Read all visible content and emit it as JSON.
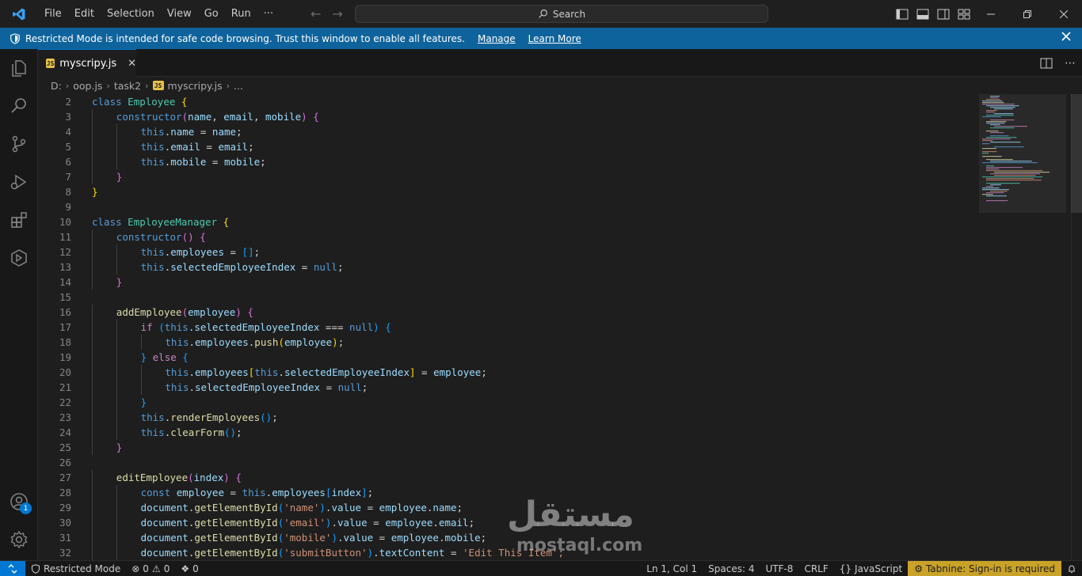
{
  "menu": [
    "File",
    "Edit",
    "Selection",
    "View",
    "Go",
    "Run",
    "···"
  ],
  "search": {
    "label": "Search"
  },
  "banner": {
    "message": "Restricted Mode is intended for safe code browsing. Trust this window to enable all features.",
    "manage": "Manage",
    "learn_more": "Learn More"
  },
  "tab": {
    "icon_text": "JS",
    "label": "myscripy.js"
  },
  "breadcrumb": [
    "D:",
    "oop.js",
    "task2",
    "myscripy.js",
    "..."
  ],
  "code_lines": [
    {
      "n": "2",
      "d": 0,
      "t": [
        [
          "kw",
          "class"
        ],
        [
          "p",
          " "
        ],
        [
          "cls",
          "Employee"
        ],
        [
          "p",
          " "
        ],
        [
          "b1",
          "{"
        ]
      ]
    },
    {
      "n": "3",
      "d": 1,
      "t": [
        [
          "kw",
          "constructor"
        ],
        [
          "b2",
          "("
        ],
        [
          "prm",
          "name"
        ],
        [
          "p",
          ", "
        ],
        [
          "prm",
          "email"
        ],
        [
          "p",
          ", "
        ],
        [
          "prm",
          "mobile"
        ],
        [
          "b2",
          ")"
        ],
        [
          "p",
          " "
        ],
        [
          "b2",
          "{"
        ]
      ]
    },
    {
      "n": "4",
      "d": 2,
      "t": [
        [
          "kw",
          "this"
        ],
        [
          "p",
          "."
        ],
        [
          "prm",
          "name"
        ],
        [
          "p",
          " = "
        ],
        [
          "prm",
          "name"
        ],
        [
          "p",
          ";"
        ]
      ]
    },
    {
      "n": "5",
      "d": 2,
      "t": [
        [
          "kw",
          "this"
        ],
        [
          "p",
          "."
        ],
        [
          "prm",
          "email"
        ],
        [
          "p",
          " = "
        ],
        [
          "prm",
          "email"
        ],
        [
          "p",
          ";"
        ]
      ]
    },
    {
      "n": "6",
      "d": 2,
      "t": [
        [
          "kw",
          "this"
        ],
        [
          "p",
          "."
        ],
        [
          "prm",
          "mobile"
        ],
        [
          "p",
          " = "
        ],
        [
          "prm",
          "mobile"
        ],
        [
          "p",
          ";"
        ]
      ]
    },
    {
      "n": "7",
      "d": 1,
      "t": [
        [
          "b2",
          "}"
        ]
      ]
    },
    {
      "n": "8",
      "d": 0,
      "t": [
        [
          "b1",
          "}"
        ]
      ]
    },
    {
      "n": "9",
      "d": 0,
      "t": []
    },
    {
      "n": "10",
      "d": 0,
      "t": [
        [
          "kw",
          "class"
        ],
        [
          "p",
          " "
        ],
        [
          "cls",
          "EmployeeManager"
        ],
        [
          "p",
          " "
        ],
        [
          "b1",
          "{"
        ]
      ]
    },
    {
      "n": "11",
      "d": 1,
      "t": [
        [
          "kw",
          "constructor"
        ],
        [
          "b2",
          "()"
        ],
        [
          "p",
          " "
        ],
        [
          "b2",
          "{"
        ]
      ]
    },
    {
      "n": "12",
      "d": 2,
      "t": [
        [
          "kw",
          "this"
        ],
        [
          "p",
          "."
        ],
        [
          "prm",
          "employees"
        ],
        [
          "p",
          " = "
        ],
        [
          "b3",
          "[]"
        ],
        [
          "p",
          ";"
        ]
      ]
    },
    {
      "n": "13",
      "d": 2,
      "t": [
        [
          "kw",
          "this"
        ],
        [
          "p",
          "."
        ],
        [
          "prm",
          "selectedEmployeeIndex"
        ],
        [
          "p",
          " = "
        ],
        [
          "kw",
          "null"
        ],
        [
          "p",
          ";"
        ]
      ]
    },
    {
      "n": "14",
      "d": 1,
      "t": [
        [
          "b2",
          "}"
        ]
      ]
    },
    {
      "n": "15",
      "d": 0,
      "t": []
    },
    {
      "n": "16",
      "d": 1,
      "t": [
        [
          "fn",
          "addEmployee"
        ],
        [
          "b2",
          "("
        ],
        [
          "prm",
          "employee"
        ],
        [
          "b2",
          ")"
        ],
        [
          "p",
          " "
        ],
        [
          "b2",
          "{"
        ]
      ]
    },
    {
      "n": "17",
      "d": 2,
      "t": [
        [
          "kw2",
          "if"
        ],
        [
          "p",
          " "
        ],
        [
          "b3",
          "("
        ],
        [
          "kw",
          "this"
        ],
        [
          "p",
          "."
        ],
        [
          "prm",
          "selectedEmployeeIndex"
        ],
        [
          "p",
          " === "
        ],
        [
          "kw",
          "null"
        ],
        [
          "b3",
          ")"
        ],
        [
          "p",
          " "
        ],
        [
          "b3",
          "{"
        ]
      ]
    },
    {
      "n": "18",
      "d": 3,
      "t": [
        [
          "kw",
          "this"
        ],
        [
          "p",
          "."
        ],
        [
          "prm",
          "employees"
        ],
        [
          "p",
          "."
        ],
        [
          "fn",
          "push"
        ],
        [
          "b1",
          "("
        ],
        [
          "prm",
          "employee"
        ],
        [
          "b1",
          ")"
        ],
        [
          "p",
          ";"
        ]
      ]
    },
    {
      "n": "19",
      "d": 2,
      "t": [
        [
          "b3",
          "}"
        ],
        [
          "p",
          " "
        ],
        [
          "kw2",
          "else"
        ],
        [
          "p",
          " "
        ],
        [
          "b3",
          "{"
        ]
      ]
    },
    {
      "n": "20",
      "d": 3,
      "t": [
        [
          "kw",
          "this"
        ],
        [
          "p",
          "."
        ],
        [
          "prm",
          "employees"
        ],
        [
          "b1",
          "["
        ],
        [
          "kw",
          "this"
        ],
        [
          "p",
          "."
        ],
        [
          "prm",
          "selectedEmployeeIndex"
        ],
        [
          "b1",
          "]"
        ],
        [
          "p",
          " = "
        ],
        [
          "prm",
          "employee"
        ],
        [
          "p",
          ";"
        ]
      ]
    },
    {
      "n": "21",
      "d": 3,
      "t": [
        [
          "kw",
          "this"
        ],
        [
          "p",
          "."
        ],
        [
          "prm",
          "selectedEmployeeIndex"
        ],
        [
          "p",
          " = "
        ],
        [
          "kw",
          "null"
        ],
        [
          "p",
          ";"
        ]
      ]
    },
    {
      "n": "22",
      "d": 2,
      "t": [
        [
          "b3",
          "}"
        ]
      ]
    },
    {
      "n": "23",
      "d": 2,
      "t": [
        [
          "kw",
          "this"
        ],
        [
          "p",
          "."
        ],
        [
          "fn",
          "renderEmployees"
        ],
        [
          "b3",
          "()"
        ],
        [
          "p",
          ";"
        ]
      ]
    },
    {
      "n": "24",
      "d": 2,
      "t": [
        [
          "kw",
          "this"
        ],
        [
          "p",
          "."
        ],
        [
          "fn",
          "clearForm"
        ],
        [
          "b3",
          "()"
        ],
        [
          "p",
          ";"
        ]
      ]
    },
    {
      "n": "25",
      "d": 1,
      "t": [
        [
          "b2",
          "}"
        ]
      ]
    },
    {
      "n": "26",
      "d": 0,
      "t": []
    },
    {
      "n": "27",
      "d": 1,
      "t": [
        [
          "fn",
          "editEmployee"
        ],
        [
          "b2",
          "("
        ],
        [
          "prm",
          "index"
        ],
        [
          "b2",
          ")"
        ],
        [
          "p",
          " "
        ],
        [
          "b2",
          "{"
        ]
      ]
    },
    {
      "n": "28",
      "d": 2,
      "t": [
        [
          "kw",
          "const"
        ],
        [
          "p",
          " "
        ],
        [
          "prm",
          "employee"
        ],
        [
          "p",
          " = "
        ],
        [
          "kw",
          "this"
        ],
        [
          "p",
          "."
        ],
        [
          "prm",
          "employees"
        ],
        [
          "b3",
          "["
        ],
        [
          "prm",
          "index"
        ],
        [
          "b3",
          "]"
        ],
        [
          "p",
          ";"
        ]
      ]
    },
    {
      "n": "29",
      "d": 2,
      "t": [
        [
          "prm",
          "document"
        ],
        [
          "p",
          "."
        ],
        [
          "fn",
          "getElementById"
        ],
        [
          "b3",
          "("
        ],
        [
          "str",
          "'name'"
        ],
        [
          "b3",
          ")"
        ],
        [
          "p",
          "."
        ],
        [
          "prm",
          "value"
        ],
        [
          "p",
          " = "
        ],
        [
          "prm",
          "employee"
        ],
        [
          "p",
          "."
        ],
        [
          "prm",
          "name"
        ],
        [
          "p",
          ";"
        ]
      ]
    },
    {
      "n": "30",
      "d": 2,
      "t": [
        [
          "prm",
          "document"
        ],
        [
          "p",
          "."
        ],
        [
          "fn",
          "getElementById"
        ],
        [
          "b3",
          "("
        ],
        [
          "str",
          "'email'"
        ],
        [
          "b3",
          ")"
        ],
        [
          "p",
          "."
        ],
        [
          "prm",
          "value"
        ],
        [
          "p",
          " = "
        ],
        [
          "prm",
          "employee"
        ],
        [
          "p",
          "."
        ],
        [
          "prm",
          "email"
        ],
        [
          "p",
          ";"
        ]
      ]
    },
    {
      "n": "31",
      "d": 2,
      "t": [
        [
          "prm",
          "document"
        ],
        [
          "p",
          "."
        ],
        [
          "fn",
          "getElementById"
        ],
        [
          "b3",
          "("
        ],
        [
          "str",
          "'mobile'"
        ],
        [
          "b3",
          ")"
        ],
        [
          "p",
          "."
        ],
        [
          "prm",
          "value"
        ],
        [
          "p",
          " = "
        ],
        [
          "prm",
          "employee"
        ],
        [
          "p",
          "."
        ],
        [
          "prm",
          "mobile"
        ],
        [
          "p",
          ";"
        ]
      ]
    },
    {
      "n": "32",
      "d": 2,
      "t": [
        [
          "prm",
          "document"
        ],
        [
          "p",
          "."
        ],
        [
          "fn",
          "getElementById"
        ],
        [
          "b3",
          "("
        ],
        [
          "str",
          "'submitButton'"
        ],
        [
          "b3",
          ")"
        ],
        [
          "p",
          "."
        ],
        [
          "prm",
          "textContent"
        ],
        [
          "p",
          " = "
        ],
        [
          "str",
          "'Edit This Item';"
        ]
      ]
    }
  ],
  "watermark": {
    "arabic": "مستقل",
    "latin": "mostaql.com"
  },
  "status": {
    "restricted": "Restricted Mode",
    "errors": "0",
    "warnings": "0",
    "ports": "0",
    "position": "Ln 1, Col 1",
    "spaces": "Spaces: 4",
    "encoding": "UTF-8",
    "eol": "CRLF",
    "language": "JavaScript",
    "tabnine": "Tabnine: Sign-in is required"
  },
  "account_badge": "1",
  "colors": {
    "accent": "#0078d4",
    "banner": "#0e639c",
    "tabnine": "#c9a227"
  }
}
